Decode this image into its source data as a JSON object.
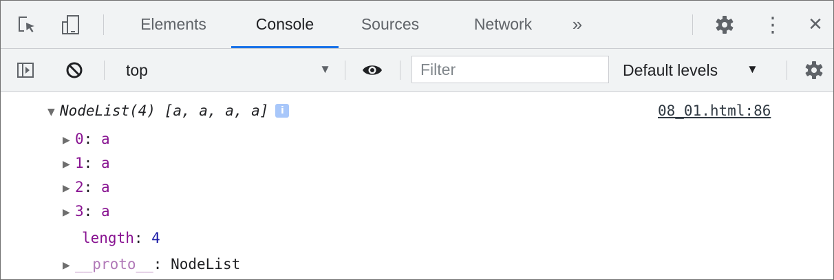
{
  "tabs": [
    {
      "label": "Elements",
      "active": false
    },
    {
      "label": "Console",
      "active": true
    },
    {
      "label": "Sources",
      "active": false
    },
    {
      "label": "Network",
      "active": false
    }
  ],
  "more_tabs_glyph": "»",
  "close_glyph": "✕",
  "kebab_glyph": "⋮",
  "toolbar": {
    "context_value": "top",
    "filter_placeholder": "Filter",
    "levels_label": "Default levels",
    "dropdown_arrow": "▼"
  },
  "console": {
    "header_title": "NodeList(4) [a, a, a, a]",
    "info_badge": "i",
    "source_link": "08_01.html:86",
    "entries": [
      {
        "key": "0",
        "value": "a"
      },
      {
        "key": "1",
        "value": "a"
      },
      {
        "key": "2",
        "value": "a"
      },
      {
        "key": "3",
        "value": "a"
      }
    ],
    "length_key": "length",
    "length_value": "4",
    "proto_key": "__proto__",
    "proto_value": "NodeList",
    "expanded_glyph": "▼",
    "collapsed_glyph": "▶",
    "colon": ": "
  },
  "colors": {
    "accent": "#1a73e8",
    "property": "#881391",
    "number": "#1a1aa6",
    "toolbar_bg": "#f1f3f4",
    "border": "#cbcdd1"
  },
  "icons": {
    "inspect": "inspect-element-icon",
    "device": "device-toolbar-icon",
    "sidebar": "console-sidebar-icon",
    "clear": "clear-console-icon",
    "eye": "live-expression-eye-icon",
    "settings": "gear-icon",
    "more": "kebab-menu-icon",
    "close": "close-icon"
  }
}
